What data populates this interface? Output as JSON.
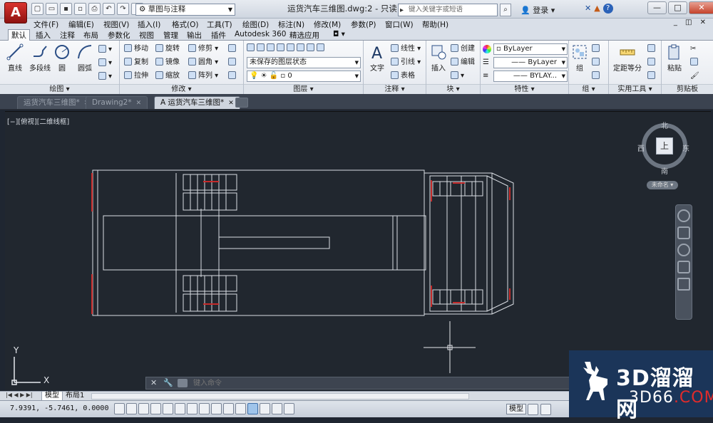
{
  "titlebar": {
    "app_logo": "A",
    "workspace": "草图与注释",
    "doc_title": "运货汽车三维图.dwg:2 - 只读",
    "search_placeholder": "键入关键字或短语",
    "signin": "登录",
    "qat_icons": [
      "new-icon",
      "open-icon",
      "save-icon",
      "saveas-icon",
      "print-icon",
      "undo-icon",
      "redo-icon",
      "dropdown-icon"
    ],
    "window_buttons": [
      "—",
      "□",
      "✕"
    ]
  },
  "menubar": {
    "items": [
      "文件(F)",
      "编辑(E)",
      "视图(V)",
      "插入(I)",
      "格式(O)",
      "工具(T)",
      "绘图(D)",
      "标注(N)",
      "修改(M)",
      "参数(P)",
      "窗口(W)",
      "帮助(H)"
    ],
    "mdi_buttons": "_ ◫ ✕"
  },
  "ribbon_tabs": {
    "items": [
      "默认",
      "插入",
      "注释",
      "布局",
      "参数化",
      "视图",
      "管理",
      "输出",
      "插件",
      "Autodesk 360",
      "精选应用"
    ],
    "active": "默认",
    "extra": "◘ ▾"
  },
  "ribbon": {
    "draw": {
      "title": "绘图 ▾",
      "line": "直线",
      "polyline": "多段线",
      "circle": "圆",
      "arc": "圆弧"
    },
    "modify": {
      "title": "修改 ▾",
      "move": "移动",
      "rotate": "旋转",
      "trim": "修剪 ▾",
      "copy": "复制",
      "mirror": "镜像",
      "fillet": "圆角 ▾",
      "stretch": "拉伸",
      "scale": "缩放",
      "array": "阵列 ▾"
    },
    "layers": {
      "title": "图层 ▾",
      "state": "未保存的图层状态",
      "current_layer": "0"
    },
    "annotation": {
      "title": "注释 ▾",
      "text": "文字",
      "linear": "线性 ▾",
      "leader": "引线 ▾",
      "table": "表格"
    },
    "block": {
      "title": "块 ▾",
      "insert": "插入",
      "create": "创建",
      "edit": "编辑"
    },
    "properties": {
      "title": "特性 ▾",
      "color": "ByLayer",
      "linetype": "ByLayer",
      "lineweight": "BYLAY..."
    },
    "groups": {
      "title": "组 ▾",
      "group": "组"
    },
    "utilities": {
      "title": "实用工具 ▾",
      "measure": "定距等分"
    },
    "clipboard": {
      "title": "剪贴板",
      "paste": "粘贴"
    }
  },
  "file_tabs": [
    {
      "label": "运货汽车三维图*",
      "close": "✕",
      "active": false
    },
    {
      "label": "Drawing2*",
      "close": "✕",
      "active": false
    },
    {
      "label": "运货汽车三维图*",
      "close": "✕",
      "active": true
    }
  ],
  "viewport": {
    "label": "[−][俯视][二维线框]",
    "viewcube": {
      "face": "上",
      "north": "北",
      "south": "南",
      "east": "东",
      "west": "西",
      "wcs": "未命名 ▾"
    },
    "ucs": {
      "x": "X",
      "y": "Y"
    }
  },
  "command": {
    "placeholder": "键入命令",
    "close": "✕",
    "wrench": "🔧"
  },
  "layout": {
    "nav": "|◀ ◀ ▶ ▶|",
    "tabs": [
      {
        "label": "模型",
        "active": true
      },
      {
        "label": "布局1",
        "active": false
      }
    ]
  },
  "statusbar": {
    "coords": "7.9391,  -5.7461, 0.0000",
    "model": "模型"
  },
  "watermark": {
    "big": "3D溜溜网",
    "small_a": "3D66",
    "small_b": ".COM"
  },
  "colors": {
    "canvas": "#21272f",
    "lines": "#d9dde3",
    "accent": "#c52a2a",
    "brand": "#1b3559"
  }
}
